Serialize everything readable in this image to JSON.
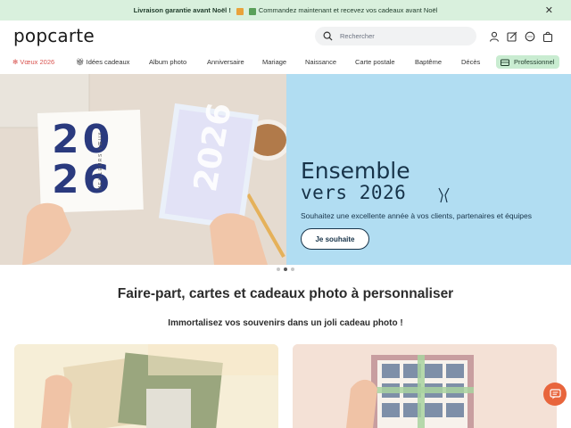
{
  "banner": {
    "bold_text": "Livraison garantie avant Noël !",
    "text": "Commandez maintenant et recevez vos cadeaux avant Noël",
    "close_icon": "close-icon"
  },
  "header": {
    "logo": "popcarte",
    "search": {
      "placeholder": "Rechercher"
    },
    "icons": [
      "user-icon",
      "edit-icon",
      "chat-icon",
      "bag-icon"
    ]
  },
  "nav": {
    "items": [
      "Vœux 2026",
      "Idées cadeaux",
      "Album photo",
      "Anniversaire",
      "Mariage",
      "Naissance",
      "Carte postale",
      "Baptême",
      "Décès",
      "Professionnel"
    ]
  },
  "hero": {
    "line1": "Ensemble",
    "line2": "vers 2026",
    "subtitle": "Souhaitez une excellente année à vos clients, partenaires et équipes",
    "cta": "Je souhaite",
    "card_year_top": "20",
    "card_year_bottom": "26",
    "card_caption": "MEILLEURS VŒUX",
    "card2_year": "2026"
  },
  "carousel": {
    "active_index": 1,
    "count": 3
  },
  "main": {
    "title": "Faire-part, cartes et cadeaux photo à personnaliser",
    "subtitle": "Immortalisez vos souvenirs dans un joli cadeau photo !"
  },
  "colors": {
    "banner_bg": "#d9f0dd",
    "hero_right_bg": "#b1ddf2",
    "hero_text": "#173349",
    "accent": "#e8653c",
    "pro_bg": "#c9ecd1"
  }
}
